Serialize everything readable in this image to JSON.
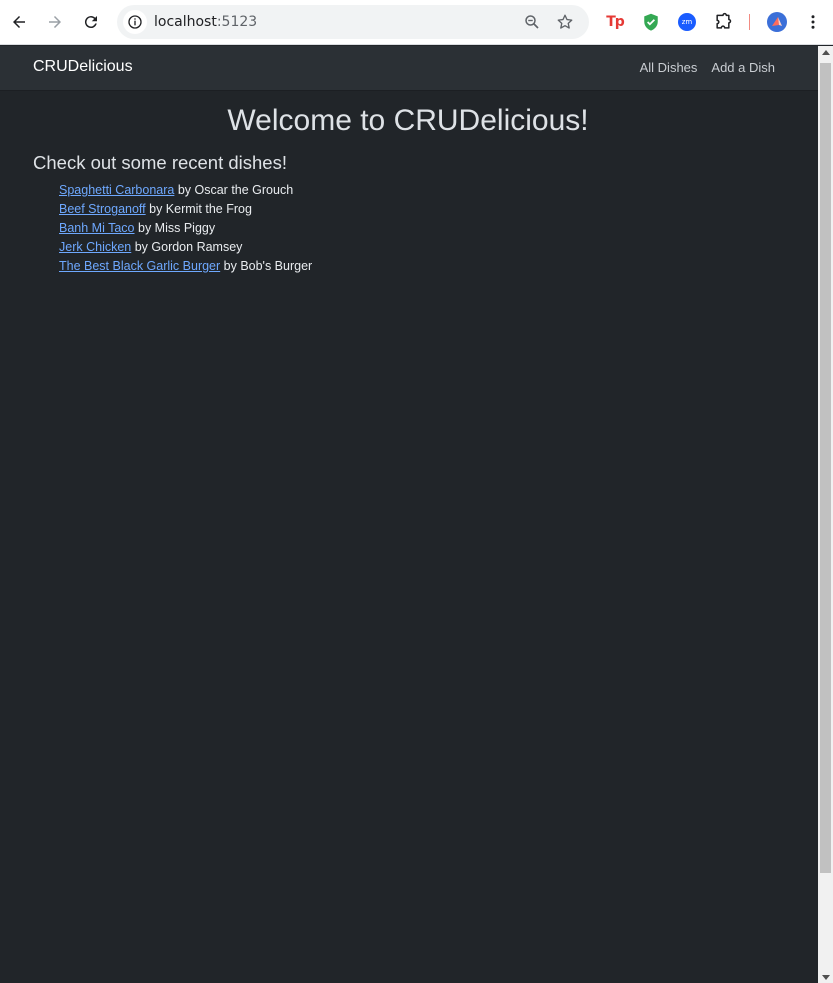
{
  "browser": {
    "url_host": "localhost",
    "url_port": ":5123"
  },
  "navbar": {
    "brand": "CRUDelicious",
    "links": [
      "All Dishes",
      "Add a Dish"
    ]
  },
  "main": {
    "title": "Welcome to CRUDelicious!",
    "subtitle": "Check out some recent dishes!",
    "dishes": [
      {
        "name": "Spaghetti Carbonara",
        "by": " by Oscar the Grouch"
      },
      {
        "name": "Beef Stroganoff",
        "by": " by Kermit the Frog"
      },
      {
        "name": "Banh Mi Taco",
        "by": " by Miss Piggy"
      },
      {
        "name": "Jerk Chicken",
        "by": " by Gordon Ramsey"
      },
      {
        "name": "The Best Black Garlic Burger",
        "by": " by Bob's Burger"
      }
    ]
  },
  "icons": [
    "back-icon",
    "forward-icon",
    "reload-icon",
    "info-icon",
    "zoom-icon",
    "star-icon",
    "tp-extension-icon",
    "shield-extension-icon",
    "zm-extension-icon",
    "puzzle-icon",
    "profile-avatar",
    "more-icon"
  ]
}
